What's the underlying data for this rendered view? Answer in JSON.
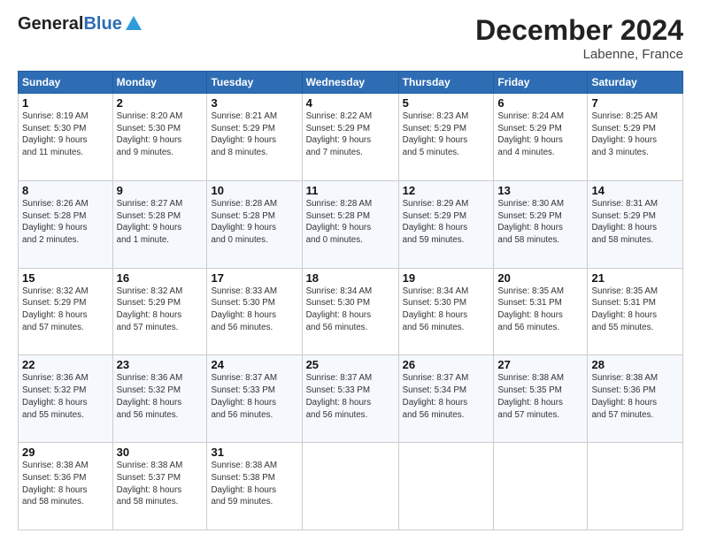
{
  "header": {
    "logo_general": "General",
    "logo_blue": "Blue",
    "month_title": "December 2024",
    "location": "Labenne, France"
  },
  "weekdays": [
    "Sunday",
    "Monday",
    "Tuesday",
    "Wednesday",
    "Thursday",
    "Friday",
    "Saturday"
  ],
  "weeks": [
    [
      {
        "day": "1",
        "info": "Sunrise: 8:19 AM\nSunset: 5:30 PM\nDaylight: 9 hours\nand 11 minutes."
      },
      {
        "day": "2",
        "info": "Sunrise: 8:20 AM\nSunset: 5:30 PM\nDaylight: 9 hours\nand 9 minutes."
      },
      {
        "day": "3",
        "info": "Sunrise: 8:21 AM\nSunset: 5:29 PM\nDaylight: 9 hours\nand 8 minutes."
      },
      {
        "day": "4",
        "info": "Sunrise: 8:22 AM\nSunset: 5:29 PM\nDaylight: 9 hours\nand 7 minutes."
      },
      {
        "day": "5",
        "info": "Sunrise: 8:23 AM\nSunset: 5:29 PM\nDaylight: 9 hours\nand 5 minutes."
      },
      {
        "day": "6",
        "info": "Sunrise: 8:24 AM\nSunset: 5:29 PM\nDaylight: 9 hours\nand 4 minutes."
      },
      {
        "day": "7",
        "info": "Sunrise: 8:25 AM\nSunset: 5:29 PM\nDaylight: 9 hours\nand 3 minutes."
      }
    ],
    [
      {
        "day": "8",
        "info": "Sunrise: 8:26 AM\nSunset: 5:28 PM\nDaylight: 9 hours\nand 2 minutes."
      },
      {
        "day": "9",
        "info": "Sunrise: 8:27 AM\nSunset: 5:28 PM\nDaylight: 9 hours\nand 1 minute."
      },
      {
        "day": "10",
        "info": "Sunrise: 8:28 AM\nSunset: 5:28 PM\nDaylight: 9 hours\nand 0 minutes."
      },
      {
        "day": "11",
        "info": "Sunrise: 8:28 AM\nSunset: 5:28 PM\nDaylight: 9 hours\nand 0 minutes."
      },
      {
        "day": "12",
        "info": "Sunrise: 8:29 AM\nSunset: 5:29 PM\nDaylight: 8 hours\nand 59 minutes."
      },
      {
        "day": "13",
        "info": "Sunrise: 8:30 AM\nSunset: 5:29 PM\nDaylight: 8 hours\nand 58 minutes."
      },
      {
        "day": "14",
        "info": "Sunrise: 8:31 AM\nSunset: 5:29 PM\nDaylight: 8 hours\nand 58 minutes."
      }
    ],
    [
      {
        "day": "15",
        "info": "Sunrise: 8:32 AM\nSunset: 5:29 PM\nDaylight: 8 hours\nand 57 minutes."
      },
      {
        "day": "16",
        "info": "Sunrise: 8:32 AM\nSunset: 5:29 PM\nDaylight: 8 hours\nand 57 minutes."
      },
      {
        "day": "17",
        "info": "Sunrise: 8:33 AM\nSunset: 5:30 PM\nDaylight: 8 hours\nand 56 minutes."
      },
      {
        "day": "18",
        "info": "Sunrise: 8:34 AM\nSunset: 5:30 PM\nDaylight: 8 hours\nand 56 minutes."
      },
      {
        "day": "19",
        "info": "Sunrise: 8:34 AM\nSunset: 5:30 PM\nDaylight: 8 hours\nand 56 minutes."
      },
      {
        "day": "20",
        "info": "Sunrise: 8:35 AM\nSunset: 5:31 PM\nDaylight: 8 hours\nand 56 minutes."
      },
      {
        "day": "21",
        "info": "Sunrise: 8:35 AM\nSunset: 5:31 PM\nDaylight: 8 hours\nand 55 minutes."
      }
    ],
    [
      {
        "day": "22",
        "info": "Sunrise: 8:36 AM\nSunset: 5:32 PM\nDaylight: 8 hours\nand 55 minutes."
      },
      {
        "day": "23",
        "info": "Sunrise: 8:36 AM\nSunset: 5:32 PM\nDaylight: 8 hours\nand 56 minutes."
      },
      {
        "day": "24",
        "info": "Sunrise: 8:37 AM\nSunset: 5:33 PM\nDaylight: 8 hours\nand 56 minutes."
      },
      {
        "day": "25",
        "info": "Sunrise: 8:37 AM\nSunset: 5:33 PM\nDaylight: 8 hours\nand 56 minutes."
      },
      {
        "day": "26",
        "info": "Sunrise: 8:37 AM\nSunset: 5:34 PM\nDaylight: 8 hours\nand 56 minutes."
      },
      {
        "day": "27",
        "info": "Sunrise: 8:38 AM\nSunset: 5:35 PM\nDaylight: 8 hours\nand 57 minutes."
      },
      {
        "day": "28",
        "info": "Sunrise: 8:38 AM\nSunset: 5:36 PM\nDaylight: 8 hours\nand 57 minutes."
      }
    ],
    [
      {
        "day": "29",
        "info": "Sunrise: 8:38 AM\nSunset: 5:36 PM\nDaylight: 8 hours\nand 58 minutes."
      },
      {
        "day": "30",
        "info": "Sunrise: 8:38 AM\nSunset: 5:37 PM\nDaylight: 8 hours\nand 58 minutes."
      },
      {
        "day": "31",
        "info": "Sunrise: 8:38 AM\nSunset: 5:38 PM\nDaylight: 8 hours\nand 59 minutes."
      },
      null,
      null,
      null,
      null
    ]
  ]
}
